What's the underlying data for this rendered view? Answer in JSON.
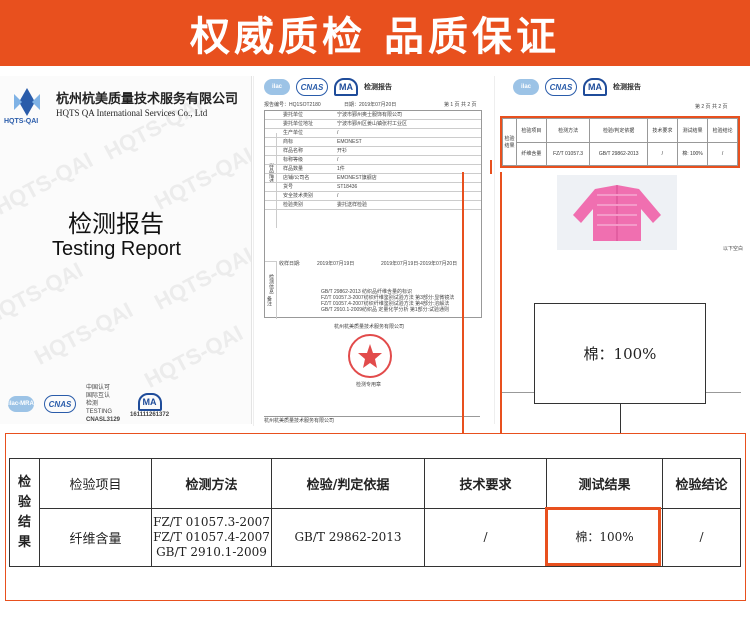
{
  "banner": {
    "title": "权威质检  品质保证"
  },
  "colors": {
    "accent": "#e8501e",
    "blue": "#2a5caa"
  },
  "cover": {
    "company_cn": "杭州杭美质量技术服务有限公司",
    "company_en": "HQTS QA International Services Co., Ltd",
    "logo_caption": "HQTS-QAI",
    "report_cn": "检测报告",
    "report_en": "Testing  Report",
    "watermark": "HQTS-QAI",
    "logos": {
      "ilac": "ilac-MRA",
      "cnas_lines": [
        "中国认可",
        "国际互认",
        "检测",
        "TESTING",
        "CNASL3129"
      ],
      "ma_no": "161111261372"
    }
  },
  "page2": {
    "title": "检测报告",
    "report_no": "报告编号：HQ1SOT2180",
    "date": "日期：2019年07月20日",
    "page_no": "第 1 页 共 2 页",
    "rows": [
      [
        "委托单位",
        "宁波市鄞州奥士服饰有限公司"
      ],
      [
        "委托单位地址",
        "宁波市鄞州区姜山镇张村工业区"
      ],
      [
        "生产单位",
        "/"
      ],
      [
        "商标",
        "EMONEST"
      ],
      [
        "样品名称",
        "开衫"
      ],
      [
        "标称等级",
        "/"
      ],
      [
        "样品数量",
        "1件"
      ],
      [
        "店铺/公司名",
        "EMONEST旗舰店"
      ],
      [
        "货号",
        "ST18436"
      ],
      [
        "安全技术类别",
        "/"
      ],
      [
        "检验类别",
        "委托送样检验"
      ]
    ],
    "received": "2019年07月19日",
    "test_period": "2019年07月19日-2019年07月20日",
    "basis_lines": [
      "GB/T 29862-2013  纺织品纤维含量的标识",
      "FZ/T 01057.3-2007纺织纤维鉴别试验方法 第3部分:显微镜法",
      "FZ/T 01057.4-2007纺织纤维鉴别试验方法 第4部分:溶解法",
      "GB/T 2910.1-2009纺织品 定量化学分析 第1部分:试验通则"
    ],
    "side_labels": [
      "样品描述",
      "检测信息",
      "备注"
    ],
    "seal_text": "杭州杭美质量技术服务有限公司",
    "seal_sub": "检测专用章",
    "footer": "杭州杭美质量技术服务有限公司"
  },
  "page3": {
    "title": "检测报告",
    "page_no": "第 2 页 共 2 页",
    "tbl_head": [
      "检验项目",
      "检测方法",
      "检验/判定依据",
      "技术要求",
      "测试结果",
      "检验结论"
    ],
    "tbl_row": [
      "纤维含量",
      "FZ/T 01057.3",
      "GB/T 29862-2013",
      "/",
      "棉: 100%",
      "/"
    ],
    "end_note": "以下空白"
  },
  "callout": {
    "text": "棉：100%"
  },
  "result_table": {
    "side_label": [
      "检",
      "验",
      "结",
      "果"
    ],
    "headers": [
      "检验项目",
      "检测方法",
      "检验/判定依据",
      "技术要求",
      "测试结果",
      "检验结论"
    ],
    "item": "纤维含量",
    "methods": [
      "FZ/T 01057.3-2007",
      "FZ/T 01057.4-2007",
      "GB/T 2910.1-2009"
    ],
    "basis": "GB/T 29862-2013",
    "requirement": "/",
    "result": "棉：100%",
    "conclusion": "/"
  }
}
